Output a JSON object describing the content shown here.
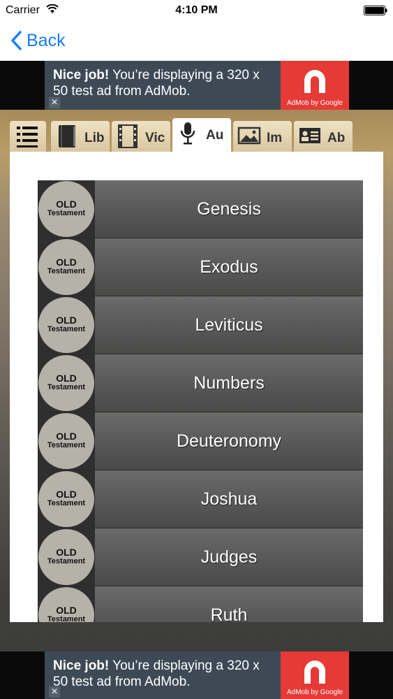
{
  "status_bar": {
    "carrier": "Carrier",
    "time": "4:10 PM"
  },
  "nav": {
    "back_label": "Back"
  },
  "ads": {
    "top": {
      "headline": "Nice job!",
      "body": "You’re displaying a 320 x 50 test ad from AdMob.",
      "brand": "AdMob by Google",
      "close": "×"
    },
    "bottom": {
      "headline": "Nice job!",
      "body": "You’re displaying a 320 x 50 test ad from AdMob.",
      "brand": "AdMob by Google",
      "close": "×"
    }
  },
  "tabs": [
    {
      "icon": "menu-icon",
      "label": ""
    },
    {
      "icon": "book-icon",
      "label": "Lib"
    },
    {
      "icon": "film-icon",
      "label": "Vic"
    },
    {
      "icon": "microphone-icon",
      "label": "Au",
      "active": true
    },
    {
      "icon": "image-icon",
      "label": "Im"
    },
    {
      "icon": "contact-card-icon",
      "label": "Ab"
    }
  ],
  "badge": {
    "line1": "OLD",
    "line2": "Testament"
  },
  "books": [
    "Genesis",
    "Exodus",
    "Leviticus",
    "Numbers",
    "Deuteronomy",
    "Joshua",
    "Judges",
    "Ruth"
  ],
  "colors": {
    "accent_blue": "#1a7cfb",
    "admob_red": "#e53a36"
  }
}
